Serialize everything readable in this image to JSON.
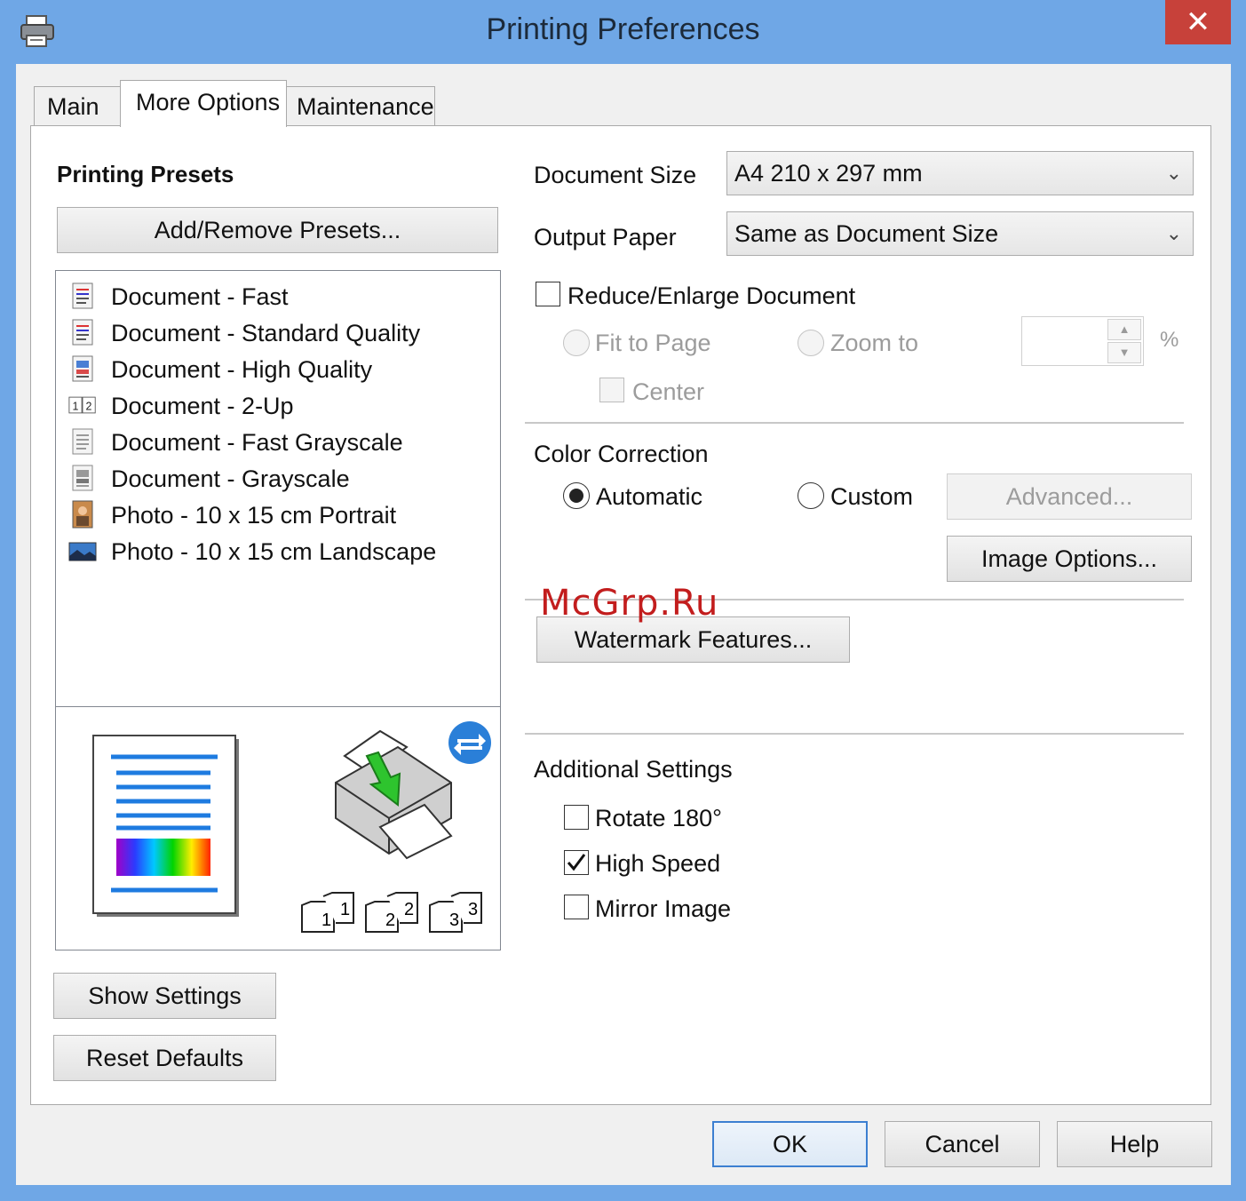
{
  "window": {
    "title": "Printing Preferences",
    "close_glyph": "✕"
  },
  "tabs": [
    {
      "label": "Main"
    },
    {
      "label": "More Options"
    },
    {
      "label": "Maintenance"
    }
  ],
  "presets": {
    "heading": "Printing Presets",
    "add_remove_label": "Add/Remove Presets...",
    "items": [
      {
        "label": "Document - Fast",
        "icon": "document-icon"
      },
      {
        "label": "Document - Standard Quality",
        "icon": "document-icon"
      },
      {
        "label": "Document - High Quality",
        "icon": "document-color-icon"
      },
      {
        "label": "Document - 2-Up",
        "icon": "two-up-icon"
      },
      {
        "label": "Document - Fast Grayscale",
        "icon": "document-gray-icon"
      },
      {
        "label": "Document - Grayscale",
        "icon": "document-gray-icon"
      },
      {
        "label": "Photo - 10 x 15 cm Portrait",
        "icon": "photo-portrait-icon"
      },
      {
        "label": "Photo - 10 x 15 cm Landscape",
        "icon": "photo-landscape-icon"
      }
    ]
  },
  "preview": {
    "copies": [
      "1",
      "2",
      "3"
    ],
    "page_lines_color": "#1e7be0",
    "status_icon_color": "#2a7fd8"
  },
  "document_size": {
    "label": "Document Size",
    "value": "A4 210 x 297 mm"
  },
  "output_paper": {
    "label": "Output Paper",
    "value": "Same as Document Size"
  },
  "reduce_enlarge": {
    "label": "Reduce/Enlarge Document",
    "checked": false,
    "fit_to_page": "Fit to Page",
    "zoom_to": "Zoom to",
    "zoom_value": "",
    "percent": "%",
    "center": "Center"
  },
  "color_correction": {
    "heading": "Color Correction",
    "automatic": "Automatic",
    "custom": "Custom",
    "selected": "Automatic",
    "advanced_label": "Advanced...",
    "image_options_label": "Image Options..."
  },
  "watermark_features_label": "Watermark Features...",
  "additional_settings": {
    "heading": "Additional Settings",
    "rotate_180": {
      "label": "Rotate 180°",
      "checked": false
    },
    "high_speed": {
      "label": "High Speed",
      "checked": true
    },
    "mirror_image": {
      "label": "Mirror Image",
      "checked": false
    }
  },
  "bottom_left": {
    "show_settings_label": "Show Settings",
    "reset_defaults_label": "Reset Defaults"
  },
  "dialog_buttons": {
    "ok": "OK",
    "cancel": "Cancel",
    "help": "Help"
  },
  "overlay_watermark": "McGrp.Ru"
}
